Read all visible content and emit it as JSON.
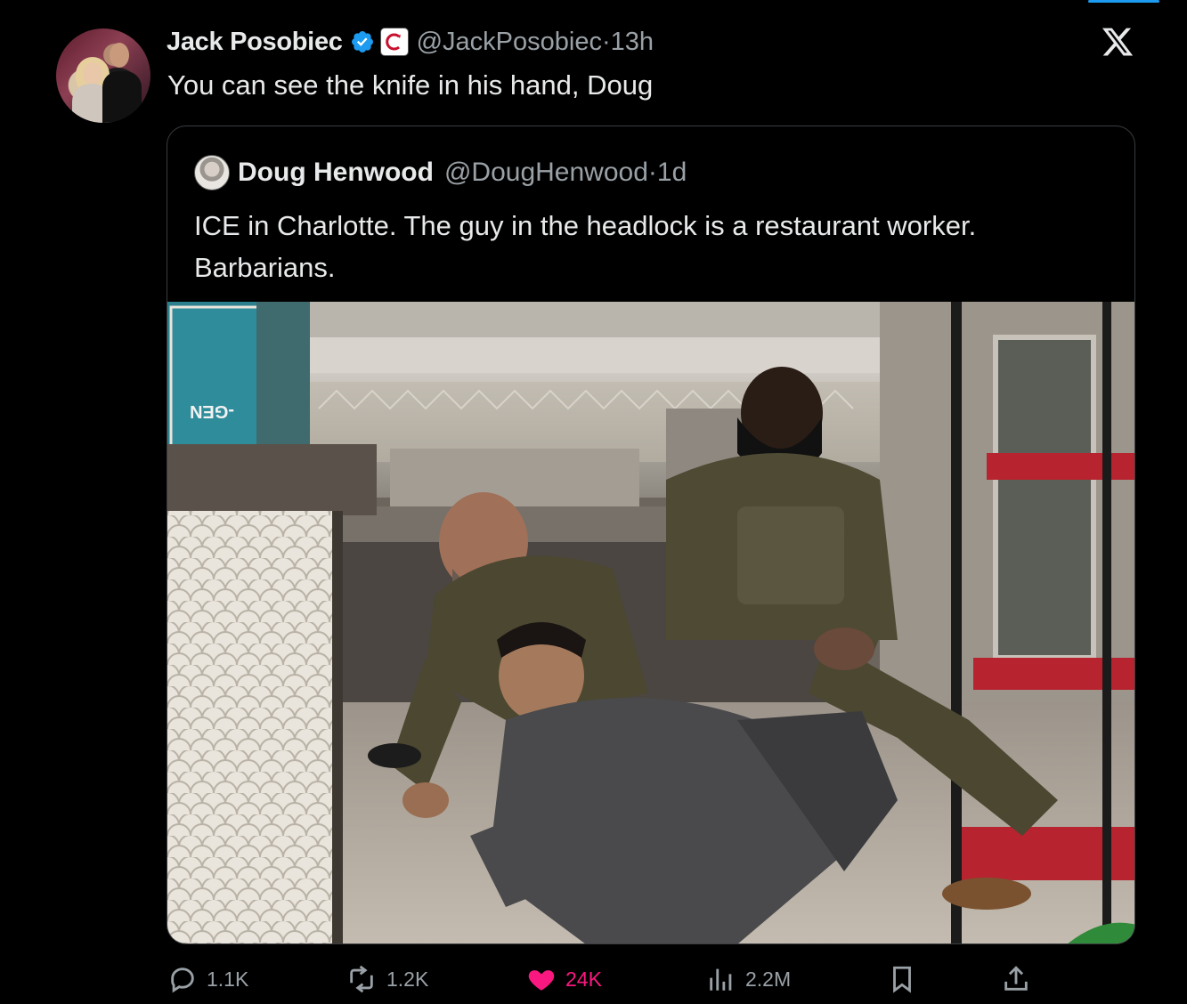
{
  "author": {
    "name": "Jack Posobiec",
    "handle": "@JackPosobiec",
    "separator": "·",
    "time": "13h",
    "avatar_icon": "profile-photo"
  },
  "tweet": {
    "text": "You can see the knife in his hand, Doug"
  },
  "quoted": {
    "name": "Doug Henwood",
    "handle": "@DougHenwood",
    "separator": "·",
    "time": "1d",
    "text_line1": "ICE in Charlotte. The guy in the headlock is a restaurant worker.",
    "text_line2": "Barbarians.",
    "sign_text": "-GEN"
  },
  "actions": {
    "replies": "1.1K",
    "reposts": "1.2K",
    "likes": "24K",
    "views": "2.2M"
  },
  "colors": {
    "background": "#000000",
    "verified_blue": "#1d9bf0",
    "like_pink": "#f91880",
    "muted_text": "#9aa1a6"
  }
}
